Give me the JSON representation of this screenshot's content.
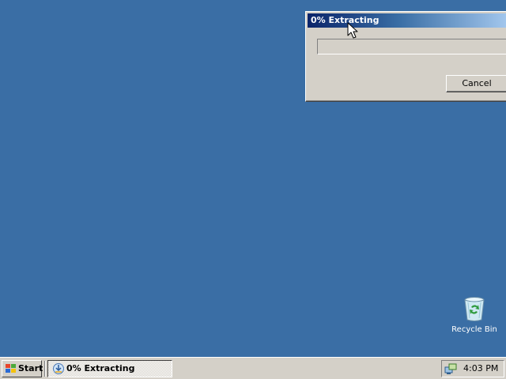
{
  "desktop": {
    "background_color": "#3a6ea5",
    "icons": [
      {
        "label": "Recycle Bin",
        "icon": "recycle-bin-icon"
      }
    ]
  },
  "dialog": {
    "title": "0% Extracting",
    "progress_percent": 0,
    "cancel_label": "Cancel"
  },
  "taskbar": {
    "start_label": "Start",
    "tasks": [
      {
        "label": "0% Extracting",
        "icon": "extract-icon",
        "active": true
      }
    ],
    "tray_icon": "network-icon",
    "clock": "4:03 PM"
  },
  "colors": {
    "title_active_start": "#0a246a",
    "title_active_end": "#a6caf0",
    "face": "#d4d0c8"
  }
}
